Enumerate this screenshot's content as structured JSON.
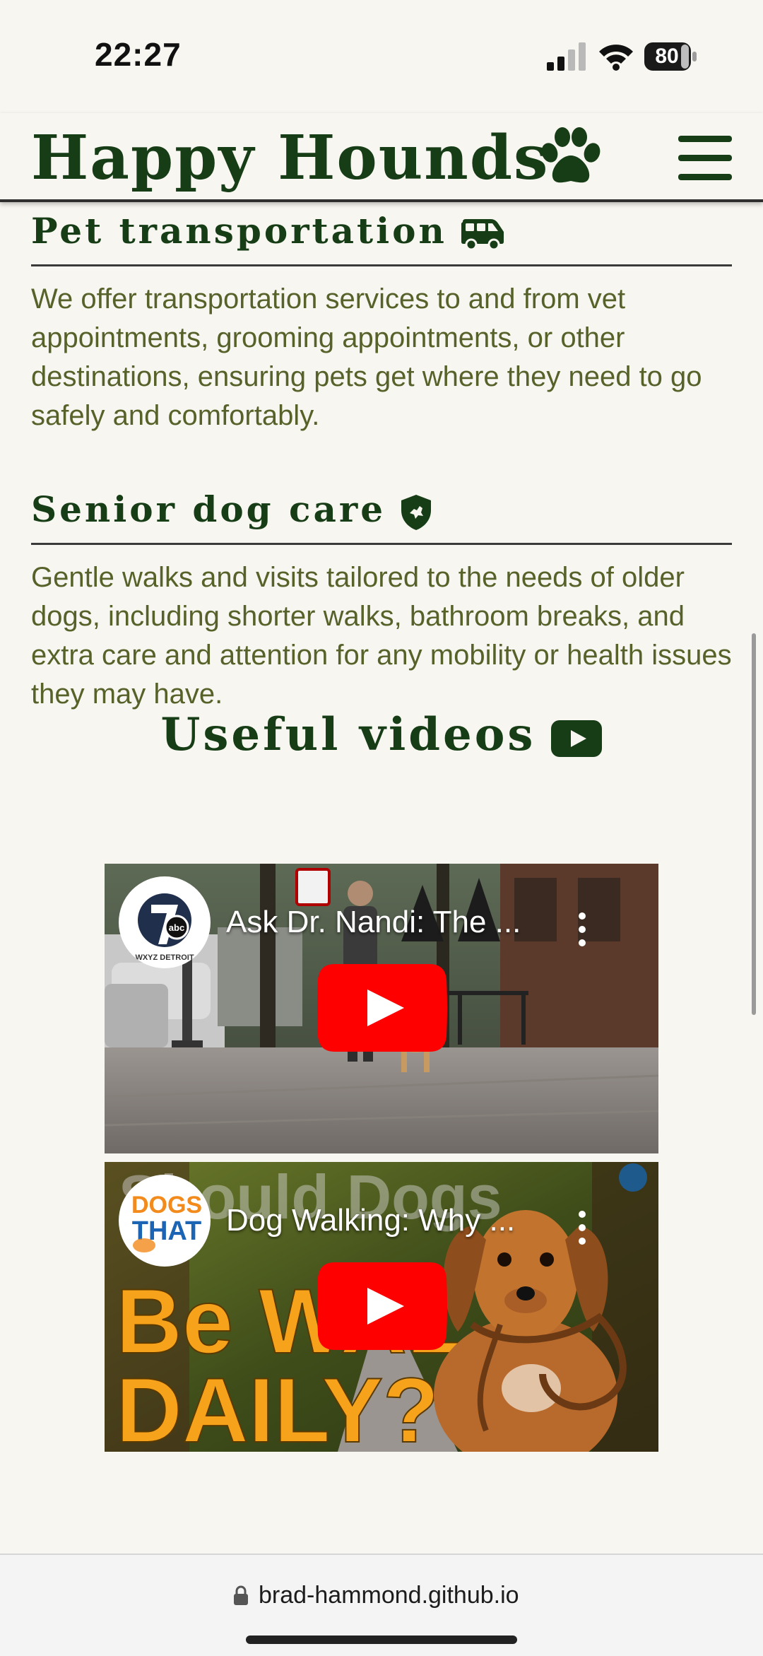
{
  "status_bar": {
    "time": "22:27",
    "battery": "80",
    "icons": [
      "signal-icon",
      "wifi-icon",
      "battery-icon"
    ]
  },
  "header": {
    "title": "Happy Hounds",
    "title_icon": "paw-icon",
    "menu_icon": "hamburger-menu-icon"
  },
  "sections": [
    {
      "heading": "Pet transportation",
      "icon": "van-icon",
      "text": "We offer transportation services to and from vet appointments, grooming appointments, or other destinations, ensuring pets get where they need to go safely and comfortably."
    },
    {
      "heading": "Senior dog care",
      "icon": "shield-dog-icon",
      "text": "Gentle walks and visits tailored to the needs of older dogs, including shorter walks, bathroom breaks, and extra care and attention for any mobility or health issues they may have."
    }
  ],
  "videos": {
    "heading": "Useful videos",
    "heading_icon": "youtube-icon",
    "items": [
      {
        "title": "Ask Dr. Nandi: The ...",
        "channel_label": "WXYZ DETROIT",
        "channel_icon": "channel-7-abc-icon"
      },
      {
        "title": "Dog Walking: Why ...",
        "channel_label_top": "DOGS",
        "channel_label_bottom": "THAT",
        "thumb_text_top": "Should Dogs",
        "thumb_text_mid": "Be WAL",
        "thumb_text_bottom": "DAILY?",
        "channel_icon": "dogs-that-icon"
      }
    ]
  },
  "browser": {
    "url": "brad-hammond.github.io",
    "lock_icon": "lock-icon"
  },
  "colors": {
    "brand_green": "#173d17",
    "body_text": "#56622a",
    "background": "#f8f6f0",
    "youtube_red": "#ff0000"
  }
}
